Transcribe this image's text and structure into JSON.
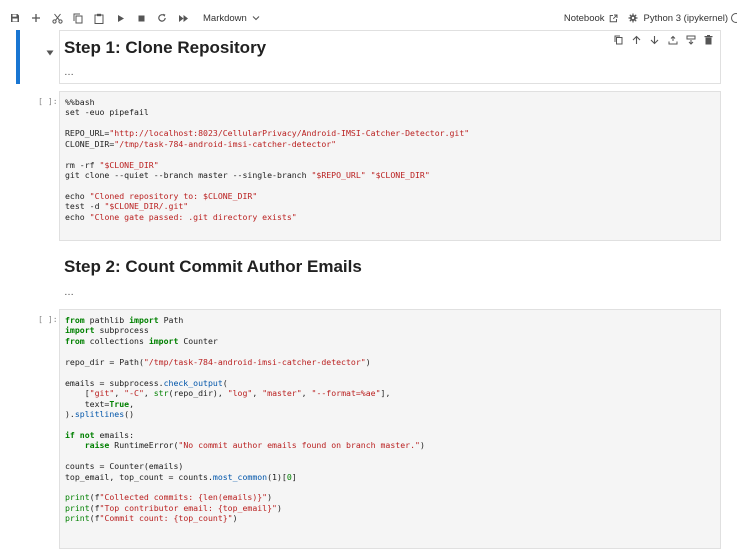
{
  "toolbar": {
    "cell_type": "Markdown",
    "notebook_label": "Notebook",
    "kernel_label": "Python 3 (ipykernel)"
  },
  "icons": [
    "save-icon",
    "add-icon",
    "cut-icon",
    "copy-icon",
    "paste-icon",
    "run-icon",
    "stop-icon",
    "restart-icon",
    "fast-forward-icon",
    "chevron-down-icon",
    "external-link-icon",
    "gear-icon",
    "kernel-status-icon",
    "duplicate-icon",
    "move-up-icon",
    "move-down-icon",
    "insert-above-icon",
    "insert-below-icon",
    "delete-icon"
  ],
  "cells": {
    "md1": {
      "heading": "Step 1: Clone Repository",
      "ellipsis": "…"
    },
    "code1": {
      "prompt": "[ ]:",
      "lines": [
        [
          {
            "t": "%%bash",
            "c": ""
          }
        ],
        [
          {
            "t": "set -euo pipefail",
            "c": ""
          }
        ],
        [
          {
            "t": "",
            "c": ""
          }
        ],
        [
          {
            "t": "REPO_URL=",
            "c": ""
          },
          {
            "t": "\"http://localhost:8023/CellularPrivacy/Android-IMSI-Catcher-Detector.git\"",
            "c": "str"
          }
        ],
        [
          {
            "t": "CLONE_DIR=",
            "c": ""
          },
          {
            "t": "\"/tmp/task-784-android-imsi-catcher-detector\"",
            "c": "str"
          }
        ],
        [
          {
            "t": "",
            "c": ""
          }
        ],
        [
          {
            "t": "rm -rf ",
            "c": ""
          },
          {
            "t": "\"$CLONE_DIR\"",
            "c": "str"
          }
        ],
        [
          {
            "t": "git clone --quiet --branch master --single-branch ",
            "c": ""
          },
          {
            "t": "\"$REPO_URL\"",
            "c": "str"
          },
          {
            "t": " ",
            "c": ""
          },
          {
            "t": "\"$CLONE_DIR\"",
            "c": "str"
          }
        ],
        [
          {
            "t": "",
            "c": ""
          }
        ],
        [
          {
            "t": "echo ",
            "c": ""
          },
          {
            "t": "\"Cloned repository to: $CLONE_DIR\"",
            "c": "str"
          }
        ],
        [
          {
            "t": "test -d ",
            "c": ""
          },
          {
            "t": "\"$CLONE_DIR/.git\"",
            "c": "str"
          }
        ],
        [
          {
            "t": "echo ",
            "c": ""
          },
          {
            "t": "\"Clone gate passed: .git directory exists\"",
            "c": "str"
          }
        ]
      ]
    },
    "md2": {
      "heading": "Step 2: Count Commit Author Emails",
      "ellipsis": "…"
    },
    "code2": {
      "prompt": "[ ]:",
      "lines": [
        [
          {
            "t": "from",
            "c": "kw"
          },
          {
            "t": " pathlib ",
            "c": ""
          },
          {
            "t": "import",
            "c": "kw"
          },
          {
            "t": " Path",
            "c": ""
          }
        ],
        [
          {
            "t": "import",
            "c": "kw"
          },
          {
            "t": " subprocess",
            "c": ""
          }
        ],
        [
          {
            "t": "from",
            "c": "kw"
          },
          {
            "t": " collections ",
            "c": ""
          },
          {
            "t": "import",
            "c": "kw"
          },
          {
            "t": " Counter",
            "c": ""
          }
        ],
        [
          {
            "t": "",
            "c": ""
          }
        ],
        [
          {
            "t": "repo_dir = Path(",
            "c": ""
          },
          {
            "t": "\"/tmp/task-784-android-imsi-catcher-detector\"",
            "c": "str"
          },
          {
            "t": ")",
            "c": ""
          }
        ],
        [
          {
            "t": "",
            "c": ""
          }
        ],
        [
          {
            "t": "emails = subprocess.",
            "c": ""
          },
          {
            "t": "check_output",
            "c": "fn"
          },
          {
            "t": "(",
            "c": ""
          }
        ],
        [
          {
            "t": "    [",
            "c": ""
          },
          {
            "t": "\"git\"",
            "c": "str"
          },
          {
            "t": ", ",
            "c": ""
          },
          {
            "t": "\"-C\"",
            "c": "str"
          },
          {
            "t": ", ",
            "c": ""
          },
          {
            "t": "str",
            "c": "bi"
          },
          {
            "t": "(repo_dir), ",
            "c": ""
          },
          {
            "t": "\"log\"",
            "c": "str"
          },
          {
            "t": ", ",
            "c": ""
          },
          {
            "t": "\"master\"",
            "c": "str"
          },
          {
            "t": ", ",
            "c": ""
          },
          {
            "t": "\"--format=%ae\"",
            "c": "str"
          },
          {
            "t": "],",
            "c": ""
          }
        ],
        [
          {
            "t": "    text=",
            "c": ""
          },
          {
            "t": "True",
            "c": "kw"
          },
          {
            "t": ",",
            "c": ""
          }
        ],
        [
          {
            "t": ").",
            "c": ""
          },
          {
            "t": "splitlines",
            "c": "fn"
          },
          {
            "t": "()",
            "c": ""
          }
        ],
        [
          {
            "t": "",
            "c": ""
          }
        ],
        [
          {
            "t": "if not",
            "c": "kw"
          },
          {
            "t": " emails:",
            "c": ""
          }
        ],
        [
          {
            "t": "    ",
            "c": ""
          },
          {
            "t": "raise",
            "c": "kw"
          },
          {
            "t": " RuntimeError(",
            "c": ""
          },
          {
            "t": "\"No commit author emails found on branch master.\"",
            "c": "str"
          },
          {
            "t": ")",
            "c": ""
          }
        ],
        [
          {
            "t": "",
            "c": ""
          }
        ],
        [
          {
            "t": "counts = Counter(emails)",
            "c": ""
          }
        ],
        [
          {
            "t": "top_email, top_count = counts.",
            "c": ""
          },
          {
            "t": "most_common",
            "c": "fn"
          },
          {
            "t": "(1)[",
            "c": ""
          },
          {
            "t": "0",
            "c": "num"
          },
          {
            "t": "]",
            "c": ""
          }
        ],
        [
          {
            "t": "",
            "c": ""
          }
        ],
        [
          {
            "t": "print",
            "c": "bi"
          },
          {
            "t": "(f",
            "c": ""
          },
          {
            "t": "\"Collected commits: {len(emails)}\"",
            "c": "str"
          },
          {
            "t": ")",
            "c": ""
          }
        ],
        [
          {
            "t": "print",
            "c": "bi"
          },
          {
            "t": "(f",
            "c": ""
          },
          {
            "t": "\"Top contributor email: {top_email}\"",
            "c": "str"
          },
          {
            "t": ")",
            "c": ""
          }
        ],
        [
          {
            "t": "print",
            "c": "bi"
          },
          {
            "t": "(f",
            "c": ""
          },
          {
            "t": "\"Commit count: {top_count}\"",
            "c": "str"
          },
          {
            "t": ")",
            "c": ""
          }
        ]
      ]
    }
  }
}
